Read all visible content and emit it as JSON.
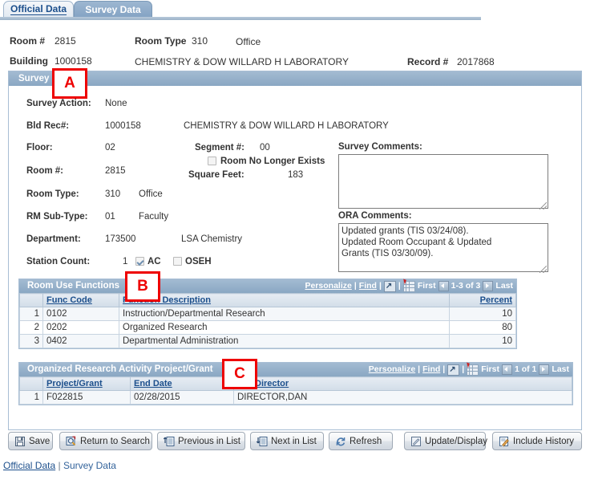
{
  "tabs": [
    {
      "label": "Official Data",
      "active": false
    },
    {
      "label": "Survey Data",
      "active": true
    }
  ],
  "header": {
    "room_label": "Room #",
    "room_value": "2815",
    "room_type_label": "Room Type",
    "room_type_value": "310",
    "room_type_desc": "Office",
    "building_label": "Building",
    "building_value": "1000158",
    "building_desc": "CHEMISTRY & DOW WILLARD H LABORATORY",
    "record_label": "Record #",
    "record_value": "2017868"
  },
  "survey_panel": {
    "title": "Survey",
    "fields": [
      {
        "label": "Survey Action:",
        "value": "None"
      },
      {
        "label": "Bld Rec#:",
        "value": "1000158",
        "extra": "CHEMISTRY & DOW WILLARD H LABORATORY"
      },
      {
        "label": "Floor:",
        "value": "02"
      },
      {
        "label": "Room #:",
        "value": "2815"
      },
      {
        "label": "Room Type:",
        "value": "310",
        "extra": "Office"
      },
      {
        "label": "RM Sub-Type:",
        "value": "01",
        "extra": "Faculty"
      },
      {
        "label": "Department:",
        "value": "173500",
        "extra": "LSA Chemistry"
      },
      {
        "label": "Station Count:",
        "value": "1"
      }
    ],
    "segment_label": "Segment #:",
    "segment_value": "00",
    "room_no_longer_exists_label": "Room No Longer Exists",
    "room_no_longer_exists_checked": false,
    "square_feet_label": "Square Feet:",
    "square_feet_value": "183",
    "ac_label": "AC",
    "ac_checked": true,
    "oseh_label": "OSEH",
    "oseh_checked": false,
    "survey_comments_label": "Survey Comments:",
    "survey_comments_value": "",
    "survey_comments_placeholder": "",
    "ora_comments_label": "ORA Comments:",
    "ora_comments_value": "Updated grants (TIS 03/24/08).\nUpdated Room Occupant & Updated\nGrants (TIS 03/30/09)."
  },
  "room_use_grid": {
    "title": "Room Use Functions",
    "nav": {
      "personalize": "Personalize",
      "find": "Find",
      "first": "First",
      "counter": "1-3 of 3",
      "last": "Last",
      "sep": "|"
    },
    "columns": [
      "Func Code",
      "Function Description",
      "Percent"
    ],
    "rows": [
      {
        "idx": "1",
        "func_code": "0102",
        "description": "Instruction/Departmental Research",
        "percent": "10"
      },
      {
        "idx": "2",
        "func_code": "0202",
        "description": "Organized Research",
        "percent": "80"
      },
      {
        "idx": "3",
        "func_code": "0402",
        "description": "Departmental Administration",
        "percent": "10"
      }
    ]
  },
  "grant_grid": {
    "title": "Organized Research Activity Project/Grant",
    "nav": {
      "personalize": "Personalize",
      "find": "Find",
      "first": "First",
      "counter": "1 of 1",
      "last": "Last",
      "sep": "|"
    },
    "columns": [
      "Project/Grant",
      "End Date",
      "P/G Director"
    ],
    "rows": [
      {
        "idx": "1",
        "project_grant": "F022815",
        "end_date": "02/28/2015",
        "director": "DIRECTOR,DAN"
      }
    ]
  },
  "toolbar": [
    {
      "label": "Save",
      "icon": "save-disk-icon"
    },
    {
      "label": "Return to Search",
      "icon": "search-return-icon"
    },
    {
      "label": "Previous in List",
      "icon": "previous-list-icon"
    },
    {
      "label": "Next in List",
      "icon": "next-list-icon"
    },
    {
      "label": "Refresh",
      "icon": "refresh-icon"
    },
    {
      "label": "Update/Display",
      "icon": "update-display-icon"
    },
    {
      "label": "Include History",
      "icon": "include-history-icon"
    }
  ],
  "footer_links": {
    "official_data": "Official Data",
    "separator": "|",
    "survey_data": "Survey Data"
  },
  "annotations": [
    {
      "label": "A"
    },
    {
      "label": "B"
    },
    {
      "label": "C"
    }
  ],
  "colors": {
    "header_blue": "#8aa7c3",
    "link_blue": "#1c4f8c",
    "annotation_red": "#ee0000",
    "panel_border": "#a8bed4"
  }
}
